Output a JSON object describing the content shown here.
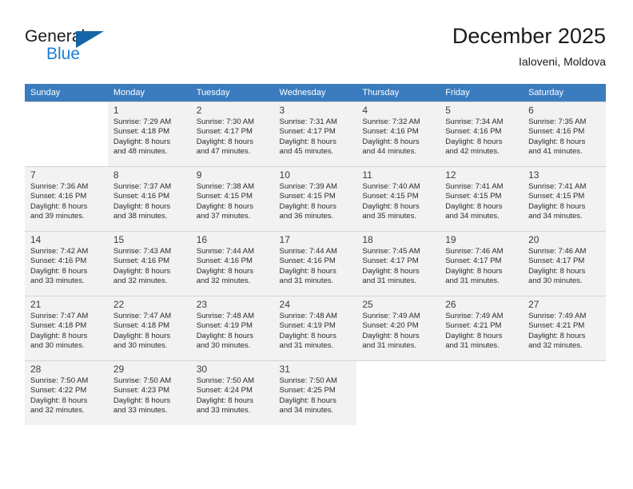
{
  "brand": {
    "word_one": "General",
    "word_two": "Blue",
    "logo_icon": "triangle-logo-icon",
    "accent_color": "#1c7fd4",
    "triangle_color": "#1565a8"
  },
  "header": {
    "title": "December 2025",
    "subtitle": "Ialoveni, Moldova"
  },
  "calendar": {
    "header_bg": "#3a7cbe",
    "header_text_color": "#ffffff",
    "shaded_cell_bg": "#f2f2f2",
    "weekdays": [
      "Sunday",
      "Monday",
      "Tuesday",
      "Wednesday",
      "Thursday",
      "Friday",
      "Saturday"
    ],
    "weeks": [
      [
        {
          "day": "",
          "lines": []
        },
        {
          "day": "1",
          "lines": [
            "Sunrise: 7:29 AM",
            "Sunset: 4:18 PM",
            "Daylight: 8 hours",
            "and 48 minutes."
          ]
        },
        {
          "day": "2",
          "lines": [
            "Sunrise: 7:30 AM",
            "Sunset: 4:17 PM",
            "Daylight: 8 hours",
            "and 47 minutes."
          ]
        },
        {
          "day": "3",
          "lines": [
            "Sunrise: 7:31 AM",
            "Sunset: 4:17 PM",
            "Daylight: 8 hours",
            "and 45 minutes."
          ]
        },
        {
          "day": "4",
          "lines": [
            "Sunrise: 7:32 AM",
            "Sunset: 4:16 PM",
            "Daylight: 8 hours",
            "and 44 minutes."
          ]
        },
        {
          "day": "5",
          "lines": [
            "Sunrise: 7:34 AM",
            "Sunset: 4:16 PM",
            "Daylight: 8 hours",
            "and 42 minutes."
          ]
        },
        {
          "day": "6",
          "lines": [
            "Sunrise: 7:35 AM",
            "Sunset: 4:16 PM",
            "Daylight: 8 hours",
            "and 41 minutes."
          ]
        }
      ],
      [
        {
          "day": "7",
          "lines": [
            "Sunrise: 7:36 AM",
            "Sunset: 4:16 PM",
            "Daylight: 8 hours",
            "and 39 minutes."
          ]
        },
        {
          "day": "8",
          "lines": [
            "Sunrise: 7:37 AM",
            "Sunset: 4:16 PM",
            "Daylight: 8 hours",
            "and 38 minutes."
          ]
        },
        {
          "day": "9",
          "lines": [
            "Sunrise: 7:38 AM",
            "Sunset: 4:15 PM",
            "Daylight: 8 hours",
            "and 37 minutes."
          ]
        },
        {
          "day": "10",
          "lines": [
            "Sunrise: 7:39 AM",
            "Sunset: 4:15 PM",
            "Daylight: 8 hours",
            "and 36 minutes."
          ]
        },
        {
          "day": "11",
          "lines": [
            "Sunrise: 7:40 AM",
            "Sunset: 4:15 PM",
            "Daylight: 8 hours",
            "and 35 minutes."
          ]
        },
        {
          "day": "12",
          "lines": [
            "Sunrise: 7:41 AM",
            "Sunset: 4:15 PM",
            "Daylight: 8 hours",
            "and 34 minutes."
          ]
        },
        {
          "day": "13",
          "lines": [
            "Sunrise: 7:41 AM",
            "Sunset: 4:15 PM",
            "Daylight: 8 hours",
            "and 34 minutes."
          ]
        }
      ],
      [
        {
          "day": "14",
          "lines": [
            "Sunrise: 7:42 AM",
            "Sunset: 4:16 PM",
            "Daylight: 8 hours",
            "and 33 minutes."
          ]
        },
        {
          "day": "15",
          "lines": [
            "Sunrise: 7:43 AM",
            "Sunset: 4:16 PM",
            "Daylight: 8 hours",
            "and 32 minutes."
          ]
        },
        {
          "day": "16",
          "lines": [
            "Sunrise: 7:44 AM",
            "Sunset: 4:16 PM",
            "Daylight: 8 hours",
            "and 32 minutes."
          ]
        },
        {
          "day": "17",
          "lines": [
            "Sunrise: 7:44 AM",
            "Sunset: 4:16 PM",
            "Daylight: 8 hours",
            "and 31 minutes."
          ]
        },
        {
          "day": "18",
          "lines": [
            "Sunrise: 7:45 AM",
            "Sunset: 4:17 PM",
            "Daylight: 8 hours",
            "and 31 minutes."
          ]
        },
        {
          "day": "19",
          "lines": [
            "Sunrise: 7:46 AM",
            "Sunset: 4:17 PM",
            "Daylight: 8 hours",
            "and 31 minutes."
          ]
        },
        {
          "day": "20",
          "lines": [
            "Sunrise: 7:46 AM",
            "Sunset: 4:17 PM",
            "Daylight: 8 hours",
            "and 30 minutes."
          ]
        }
      ],
      [
        {
          "day": "21",
          "lines": [
            "Sunrise: 7:47 AM",
            "Sunset: 4:18 PM",
            "Daylight: 8 hours",
            "and 30 minutes."
          ]
        },
        {
          "day": "22",
          "lines": [
            "Sunrise: 7:47 AM",
            "Sunset: 4:18 PM",
            "Daylight: 8 hours",
            "and 30 minutes."
          ]
        },
        {
          "day": "23",
          "lines": [
            "Sunrise: 7:48 AM",
            "Sunset: 4:19 PM",
            "Daylight: 8 hours",
            "and 30 minutes."
          ]
        },
        {
          "day": "24",
          "lines": [
            "Sunrise: 7:48 AM",
            "Sunset: 4:19 PM",
            "Daylight: 8 hours",
            "and 31 minutes."
          ]
        },
        {
          "day": "25",
          "lines": [
            "Sunrise: 7:49 AM",
            "Sunset: 4:20 PM",
            "Daylight: 8 hours",
            "and 31 minutes."
          ]
        },
        {
          "day": "26",
          "lines": [
            "Sunrise: 7:49 AM",
            "Sunset: 4:21 PM",
            "Daylight: 8 hours",
            "and 31 minutes."
          ]
        },
        {
          "day": "27",
          "lines": [
            "Sunrise: 7:49 AM",
            "Sunset: 4:21 PM",
            "Daylight: 8 hours",
            "and 32 minutes."
          ]
        }
      ],
      [
        {
          "day": "28",
          "lines": [
            "Sunrise: 7:50 AM",
            "Sunset: 4:22 PM",
            "Daylight: 8 hours",
            "and 32 minutes."
          ]
        },
        {
          "day": "29",
          "lines": [
            "Sunrise: 7:50 AM",
            "Sunset: 4:23 PM",
            "Daylight: 8 hours",
            "and 33 minutes."
          ]
        },
        {
          "day": "30",
          "lines": [
            "Sunrise: 7:50 AM",
            "Sunset: 4:24 PM",
            "Daylight: 8 hours",
            "and 33 minutes."
          ]
        },
        {
          "day": "31",
          "lines": [
            "Sunrise: 7:50 AM",
            "Sunset: 4:25 PM",
            "Daylight: 8 hours",
            "and 34 minutes."
          ]
        },
        {
          "day": "",
          "lines": []
        },
        {
          "day": "",
          "lines": []
        },
        {
          "day": "",
          "lines": []
        }
      ]
    ]
  }
}
